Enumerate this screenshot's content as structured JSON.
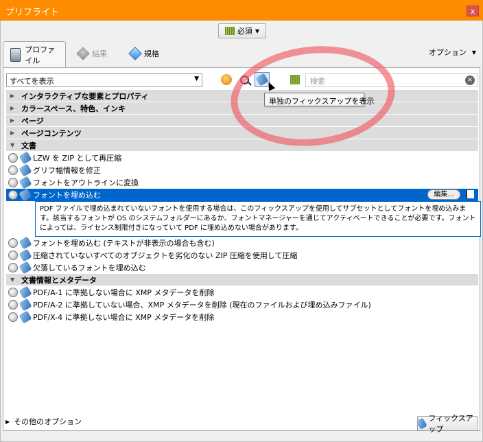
{
  "window": {
    "title": "プリフライト",
    "close": "x"
  },
  "header": {
    "required_button": "必須"
  },
  "tabs": [
    {
      "label": "プロファイル",
      "icon": "printer-icon",
      "active": true
    },
    {
      "label": "結果",
      "icon": "wrench-grey-icon",
      "active": false
    },
    {
      "label": "規格",
      "icon": "diamond-icon",
      "active": false
    }
  ],
  "options_menu": "オプション",
  "toolbar": {
    "filter_value": "すべてを表示",
    "search_placeholder": "検索",
    "tooltip": "単独のフィックスアップを表示"
  },
  "categories": [
    {
      "label": "インタラクティブな要素とプロパティ",
      "expanded": false
    },
    {
      "label": "カラースペース、特色、インキ",
      "expanded": false
    },
    {
      "label": "ページ",
      "expanded": false
    },
    {
      "label": "ページコンテンツ",
      "expanded": false
    },
    {
      "label": "文書",
      "expanded": true
    },
    {
      "label": "文書情報とメタデータ",
      "expanded": true
    }
  ],
  "document_fixups": [
    "LZW を ZIP として再圧縮",
    "グリフ幅情報を修正",
    "フォントをアウトラインに変換",
    "フォントを埋め込む",
    "フォントを埋め込む (テキストが非表示の場合も含む)",
    "圧縮されていないすべてのオブジェクトを劣化のない ZIP 圧縮を使用して圧縮",
    "欠落しているフォントを埋め込む"
  ],
  "selected_fixup": {
    "label": "フォントを埋め込む",
    "edit_button": "編集...",
    "description": "PDF ファイルで埋め込まれていないフォントを使用する場合は、このフィックスアップを使用してサブセットとしてフォントを埋め込みます。該当するフォントが OS のシステムフォルダーにあるか、フォントマネージャーを通じてアクティベートできることが必要です。フォントによっては、ライセンス制限付きになっていて PDF に埋め込めない場合があります。"
  },
  "metadata_fixups": [
    "PDF/A-1 に準拠しない場合に XMP メタデータを削除",
    "PDF/A-2 に準拠していない場合、XMP メタデータを削除 (現在のファイルおよび埋め込みファイル)",
    "PDF/X-4 に準拠しない場合に XMP メタデータを削除"
  ],
  "footer": {
    "more_options": "その他のオプション",
    "fixup_button": "フィックスアップ"
  },
  "colors": {
    "titlebar": "#ff8c00",
    "selection": "#0066cc",
    "category_bg": "#dcdcdc"
  }
}
